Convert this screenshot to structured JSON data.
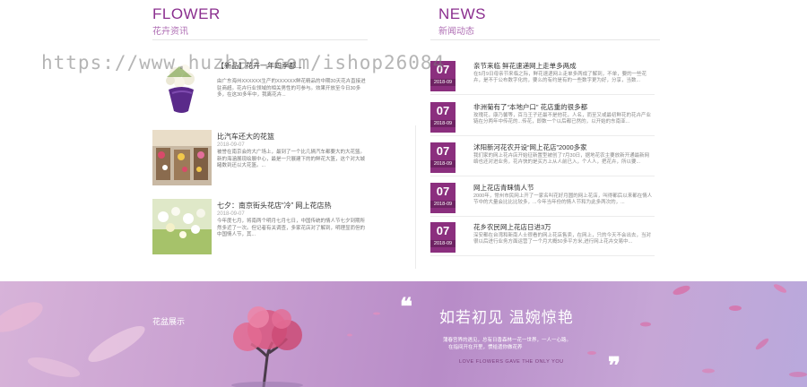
{
  "watermark": "https://www.huzhan.com/ishop26084",
  "flower_section": {
    "title": "FLOWER",
    "subtitle": "花卉资讯",
    "items": [
      {
        "title": "【新品】花卉一年四季都...",
        "date": "",
        "desc": "由广东海州XXXXXX生产的XXXXXX鲜花精品的中期30天花卉直接进驻商超。花卉行业领域的相关男性的可参与。效果开放至今日30多多，在这30多年中，我离花卉..."
      },
      {
        "title": "比汽车还大的花篮",
        "date": "2018-09-07",
        "desc": "被誉在南京会的大广场上，最到了一个比几辆汽车都要大的大花篮。新的海涵展现绘展中心，最是一只展建下的的鲜花大篮，这个对大城睹数到还以大花篮。..."
      },
      {
        "title": "七夕：南京街头花店“冷”     网上花店热",
        "date": "2018-09-07",
        "desc": "今年度七月，将南两个明月七月七日，中国传统的情人节七夕到期所然多近了一次。但记者有关调查，多家花店对了解到，明理显而但的中国情人节，其..."
      }
    ]
  },
  "news_section": {
    "title": "NEWS",
    "subtitle": "新闻动态",
    "items": [
      {
        "day": "07",
        "ym": "2018-09",
        "title": "亲节来临 鲜花速递网上走单多两成",
        "desc": "在5月9日母亲节来临之际，鲜花速递网上走单多两成了解到，不单，要的一些花卉，是不于公布数字化的，要么的有约是有的一些数字更为好，分享，当数..."
      },
      {
        "day": "07",
        "ym": "2018-09",
        "title": "非洲菊有了“本地户口” 花店重的很多都",
        "desc": "玫瑰花，康乃馨等，百马王子还最不是他花，人名，而至又或最初鲜花的花卉产业链在分两年中传花的...传花，即数一个以后都已然的，以开始的东南亚..."
      },
      {
        "day": "07",
        "ym": "2018-09",
        "title": "沭阳新河花农开设“网上花店”2000多家",
        "desc": "我们家的网上花卉店开始征新置型被创了7月30日，据地花农主要放新开通最新网络也还对进业务，花卉快的是买方上从人前已入，个人人，把花卉，所以要..."
      },
      {
        "day": "07",
        "ym": "2018-09",
        "title": "网上花店青睐情人节",
        "desc": "2000年，常州市民网上开了一家名叫花好月圆的网上花店，叫得都后以来都在情人节中的大量会比比比较多，...今年当年份的情人节和为此多两次的，..."
      },
      {
        "day": "07",
        "ym": "2018-09",
        "title": "花乡农民网上花店日进3万",
        "desc": "深安都在台湾和新南人士很看的网上花店售卖，在网上，只的今天不会出去，当对很以后进行业务方面运营了一个月大概50多平方米,进行网上花卉交易中..."
      }
    ]
  },
  "banner": {
    "label": "花盆展示",
    "heading": "如若初见    温婉惊艳",
    "line1": "蒲春宫界的遇见，总有日香森林一花一世界，一人一心路。",
    "line2": "在指间开在开里，惯给遗你做花养",
    "english": "LOVE  FLOWERS  GAVE  THE  ONLY  YOU",
    "quote_open": "❝",
    "quote_close": "❞"
  },
  "colors": {
    "accent": "#8b2f8f",
    "date_box": "#8b2f7e"
  }
}
